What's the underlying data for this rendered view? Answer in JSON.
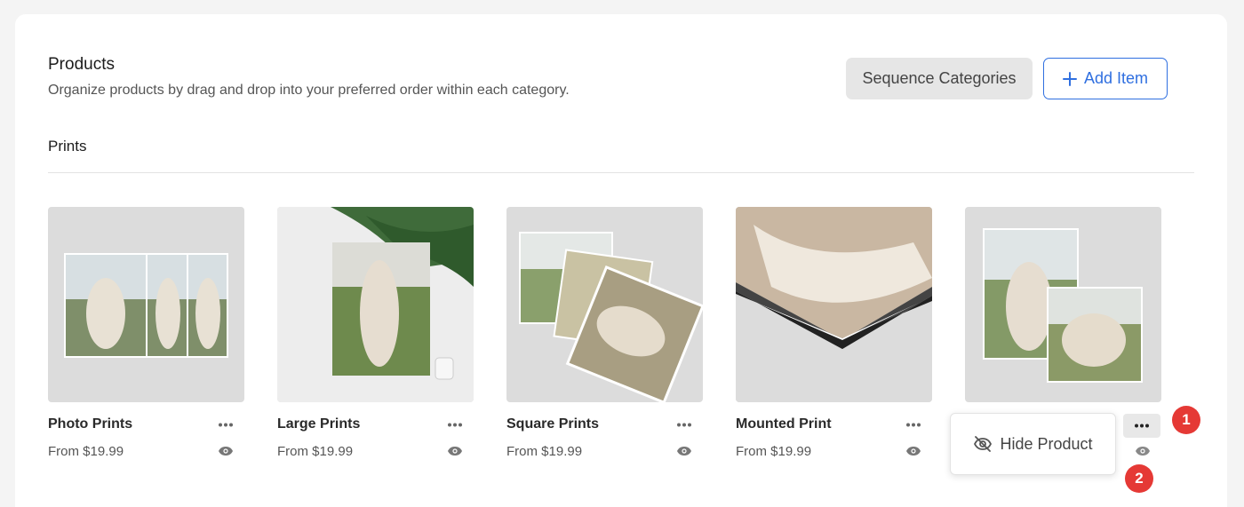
{
  "header": {
    "title": "Products",
    "subtitle": "Organize products by drag and drop into your preferred order within each category.",
    "sequence_label": "Sequence Categories",
    "add_label": "Add Item"
  },
  "section": {
    "title": "Prints"
  },
  "products": [
    {
      "name": "Photo Prints",
      "price": "From $19.99"
    },
    {
      "name": "Large Prints",
      "price": "From $19.99"
    },
    {
      "name": "Square Prints",
      "price": "From $19.99"
    },
    {
      "name": "Mounted Print",
      "price": "From $19.99"
    }
  ],
  "menu": {
    "hide_label": "Hide Product"
  },
  "badges": [
    "1",
    "2"
  ],
  "colors": {
    "accent": "#2f6fe0",
    "badge": "#e53935",
    "thumb_bg": "#dcdcdc"
  },
  "icons": [
    "plus-icon",
    "more-icon",
    "eye-icon",
    "eye-off-icon"
  ]
}
